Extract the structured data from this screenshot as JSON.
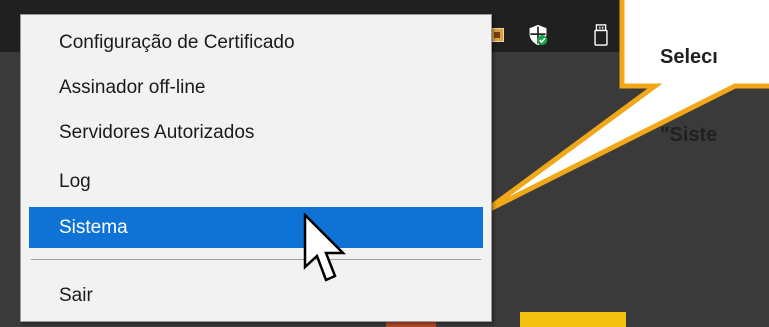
{
  "callout": {
    "line1": "Selecı",
    "line2": "\"Siste"
  },
  "menu": {
    "items": [
      {
        "label": "Configuração de Certificado"
      },
      {
        "label": "Assinador off-line"
      },
      {
        "label": "Servidores Autorizados"
      },
      {
        "label": "Log"
      },
      {
        "label": "Sistema"
      },
      {
        "label": "Sair"
      }
    ],
    "highlighted": "Sistema"
  },
  "colors": {
    "highlight": "#0f73d6",
    "callout_border": "#f0a818",
    "callout_fill": "#ffffff",
    "taskbar": "#202020",
    "desktop": "#3a3a3a"
  },
  "icons": {
    "tray": [
      "app-tray-icon",
      "security-shield-icon",
      "usb-device-icon"
    ],
    "pointer": "mouse-pointer-icon"
  }
}
